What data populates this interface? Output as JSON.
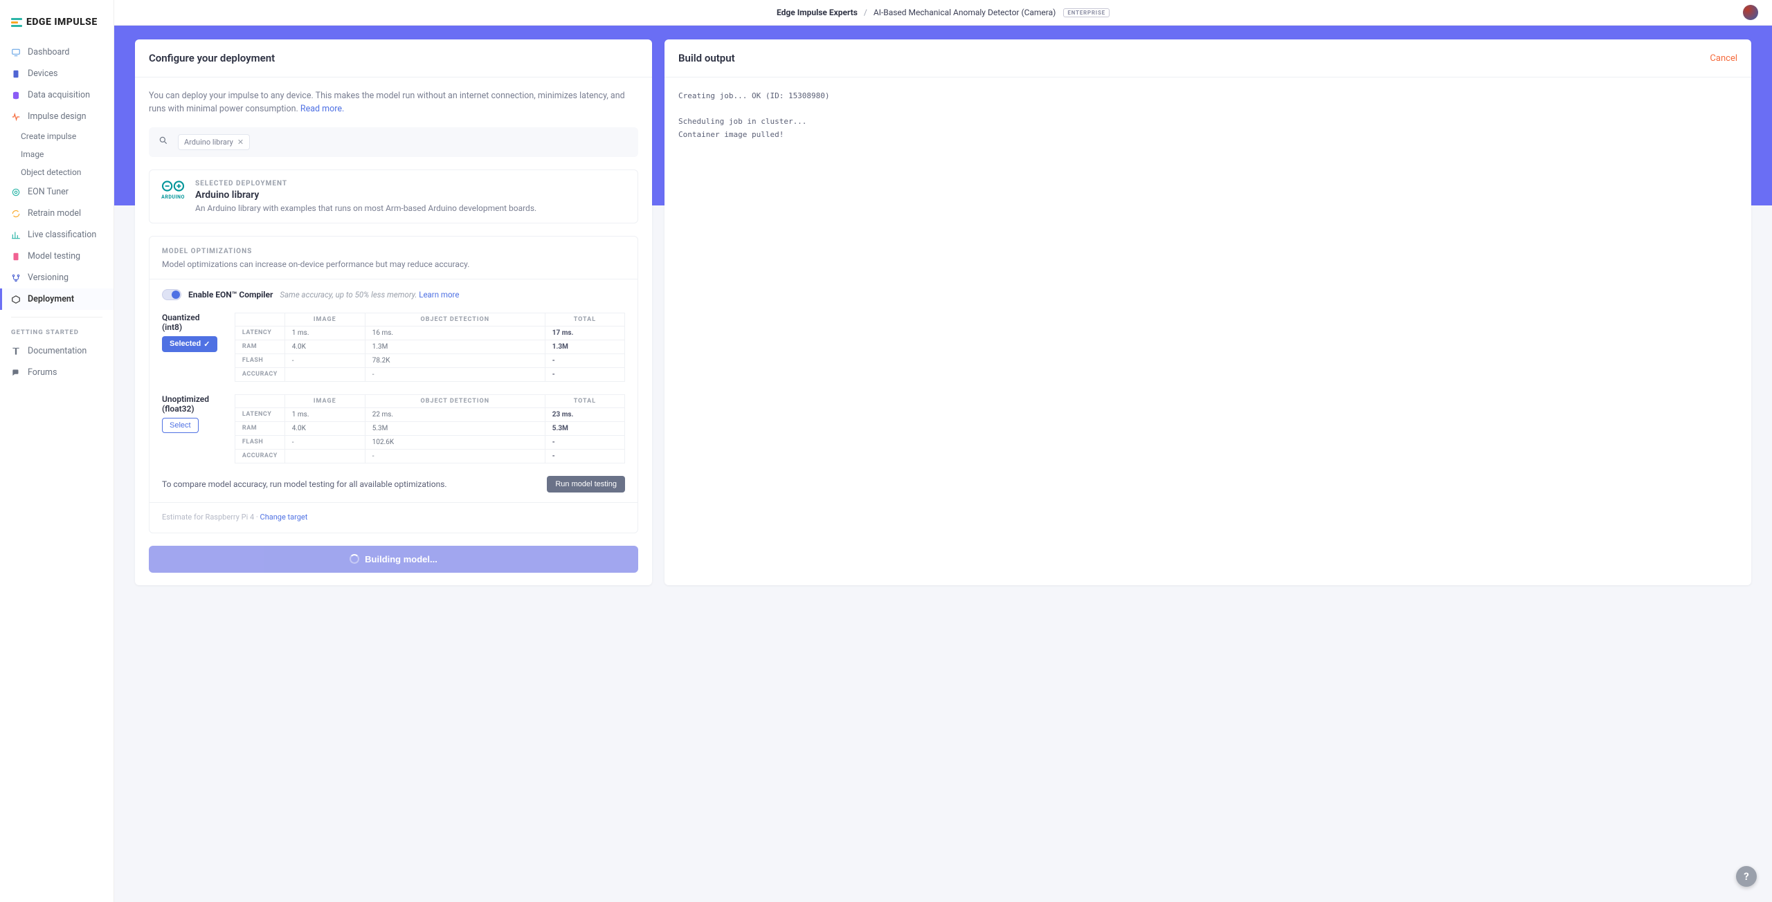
{
  "brand": "EDGE IMPULSE",
  "breadcrumb": {
    "org": "Edge Impulse Experts",
    "project": "AI-Based Mechanical Anomaly Detector (Camera)",
    "tier": "ENTERPRISE"
  },
  "sidebar": {
    "items": [
      {
        "label": "Dashboard"
      },
      {
        "label": "Devices"
      },
      {
        "label": "Data acquisition"
      },
      {
        "label": "Impulse design"
      },
      {
        "label": "EON Tuner"
      },
      {
        "label": "Retrain model"
      },
      {
        "label": "Live classification"
      },
      {
        "label": "Model testing"
      },
      {
        "label": "Versioning"
      },
      {
        "label": "Deployment"
      }
    ],
    "impulse_sub": [
      {
        "label": "Create impulse"
      },
      {
        "label": "Image"
      },
      {
        "label": "Object detection"
      }
    ],
    "getting_started_header": "GETTING STARTED",
    "footer": [
      {
        "label": "Documentation"
      },
      {
        "label": "Forums"
      }
    ]
  },
  "configure": {
    "title": "Configure your deployment",
    "intro": "You can deploy your impulse to any device. This makes the model run without an internet connection, minimizes latency, and runs with minimal power consumption.",
    "read_more": "Read more.",
    "search_chip": "Arduino library",
    "deployment": {
      "label": "SELECTED DEPLOYMENT",
      "name": "Arduino library",
      "desc": "An Arduino library with examples that runs on most Arm-based Arduino development boards.",
      "logo_text": "ARDUINO"
    },
    "opt": {
      "label": "MODEL OPTIMIZATIONS",
      "desc": "Model optimizations can increase on-device performance but may reduce accuracy.",
      "toggle_label": "Enable EON™ Compiler",
      "toggle_hint": "Same accuracy, up to 50% less memory.",
      "learn_more": "Learn more",
      "columns": [
        "",
        "IMAGE",
        "OBJECT DETECTION",
        "TOTAL"
      ],
      "row_labels": [
        "LATENCY",
        "RAM",
        "FLASH",
        "ACCURACY"
      ],
      "quantized": {
        "name": "Quantized (int8)",
        "button": "Selected",
        "rows": [
          [
            "1 ms.",
            "16 ms.",
            "17 ms."
          ],
          [
            "4.0K",
            "1.3M",
            "1.3M"
          ],
          [
            "-",
            "78.2K",
            "-"
          ],
          [
            "",
            "-",
            "-"
          ]
        ]
      },
      "unoptimized": {
        "name": "Unoptimized (float32)",
        "button": "Select",
        "rows": [
          [
            "1 ms.",
            "22 ms.",
            "23 ms."
          ],
          [
            "4.0K",
            "5.3M",
            "5.3M"
          ],
          [
            "-",
            "102.6K",
            "-"
          ],
          [
            "",
            "-",
            "-"
          ]
        ]
      },
      "compare_text": "To compare model accuracy, run model testing for all available optimizations.",
      "run_testing_btn": "Run model testing",
      "estimate_pre": "Estimate for Raspberry Pi 4 ·",
      "estimate_link": "Change target"
    },
    "build_btn": "Building model..."
  },
  "build_output": {
    "title": "Build output",
    "cancel": "Cancel",
    "log": "Creating job... OK (ID: 15308980)\n\nScheduling job in cluster...\nContainer image pulled!"
  }
}
